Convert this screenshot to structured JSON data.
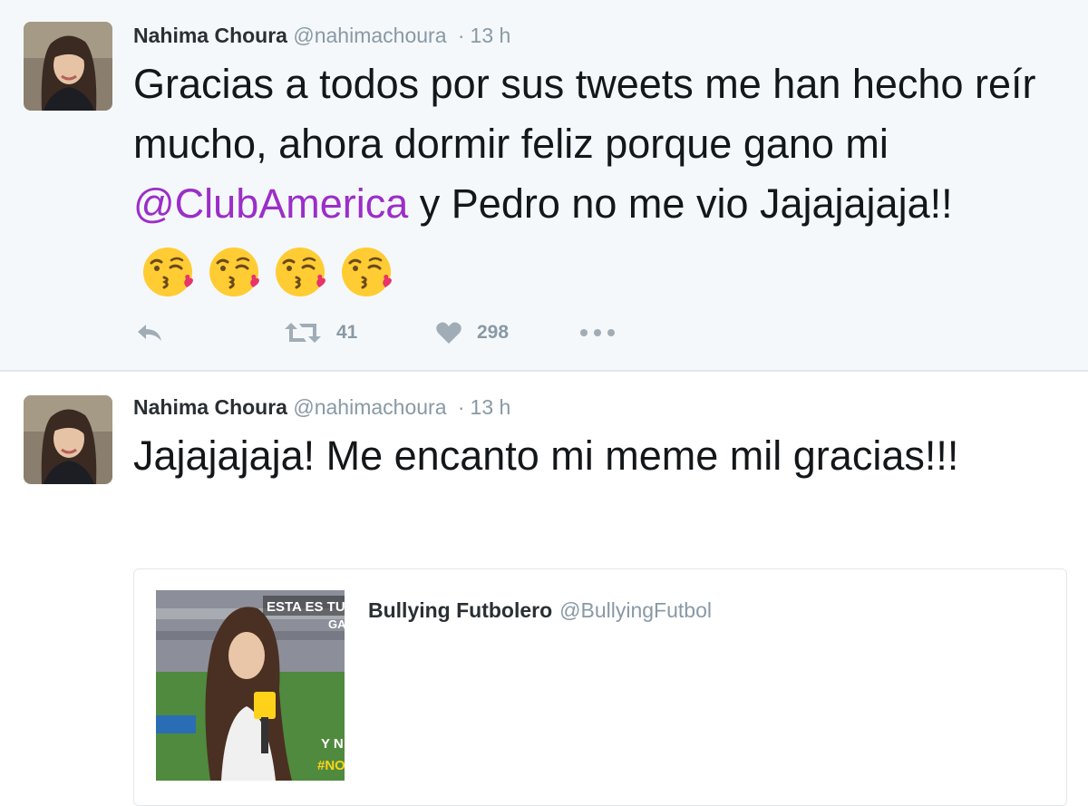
{
  "tweets": [
    {
      "author_name": "Nahima Choura",
      "author_handle": "@nahimachoura",
      "separator": "·",
      "timestamp": "13 h",
      "text_part1": "Gracias a todos por sus tweets me han hecho reír mucho, ahora dormir feliz porque gano mi ",
      "mention": "@ClubAmerica",
      "text_part2": " y Pedro no me vio Jajajajaja!!",
      "emoji": "kissing-face-emoji",
      "emoji_count": 4,
      "retweet_count": "41",
      "like_count": "298"
    },
    {
      "author_name": "Nahima Choura",
      "author_handle": "@nahimachoura",
      "separator": "·",
      "timestamp": "13 h",
      "text": "Jajajajaja! Me encanto mi meme mil gracias!!!",
      "quoted": {
        "author_name": "Bullying Futbolero",
        "author_handle": "@BullyingFutbol",
        "image_caption_1": "ESTA ES TU",
        "image_caption_2": "GA",
        "image_caption_3": "Y N",
        "image_caption_4": "#NO"
      }
    }
  ],
  "colors": {
    "mention": "#9b2ec8",
    "muted": "#8899a6",
    "tweet_bg_highlight": "#f5f8fa"
  },
  "icons": {
    "reply": "reply-icon",
    "retweet": "retweet-icon",
    "like": "heart-icon",
    "more": "more-icon"
  }
}
